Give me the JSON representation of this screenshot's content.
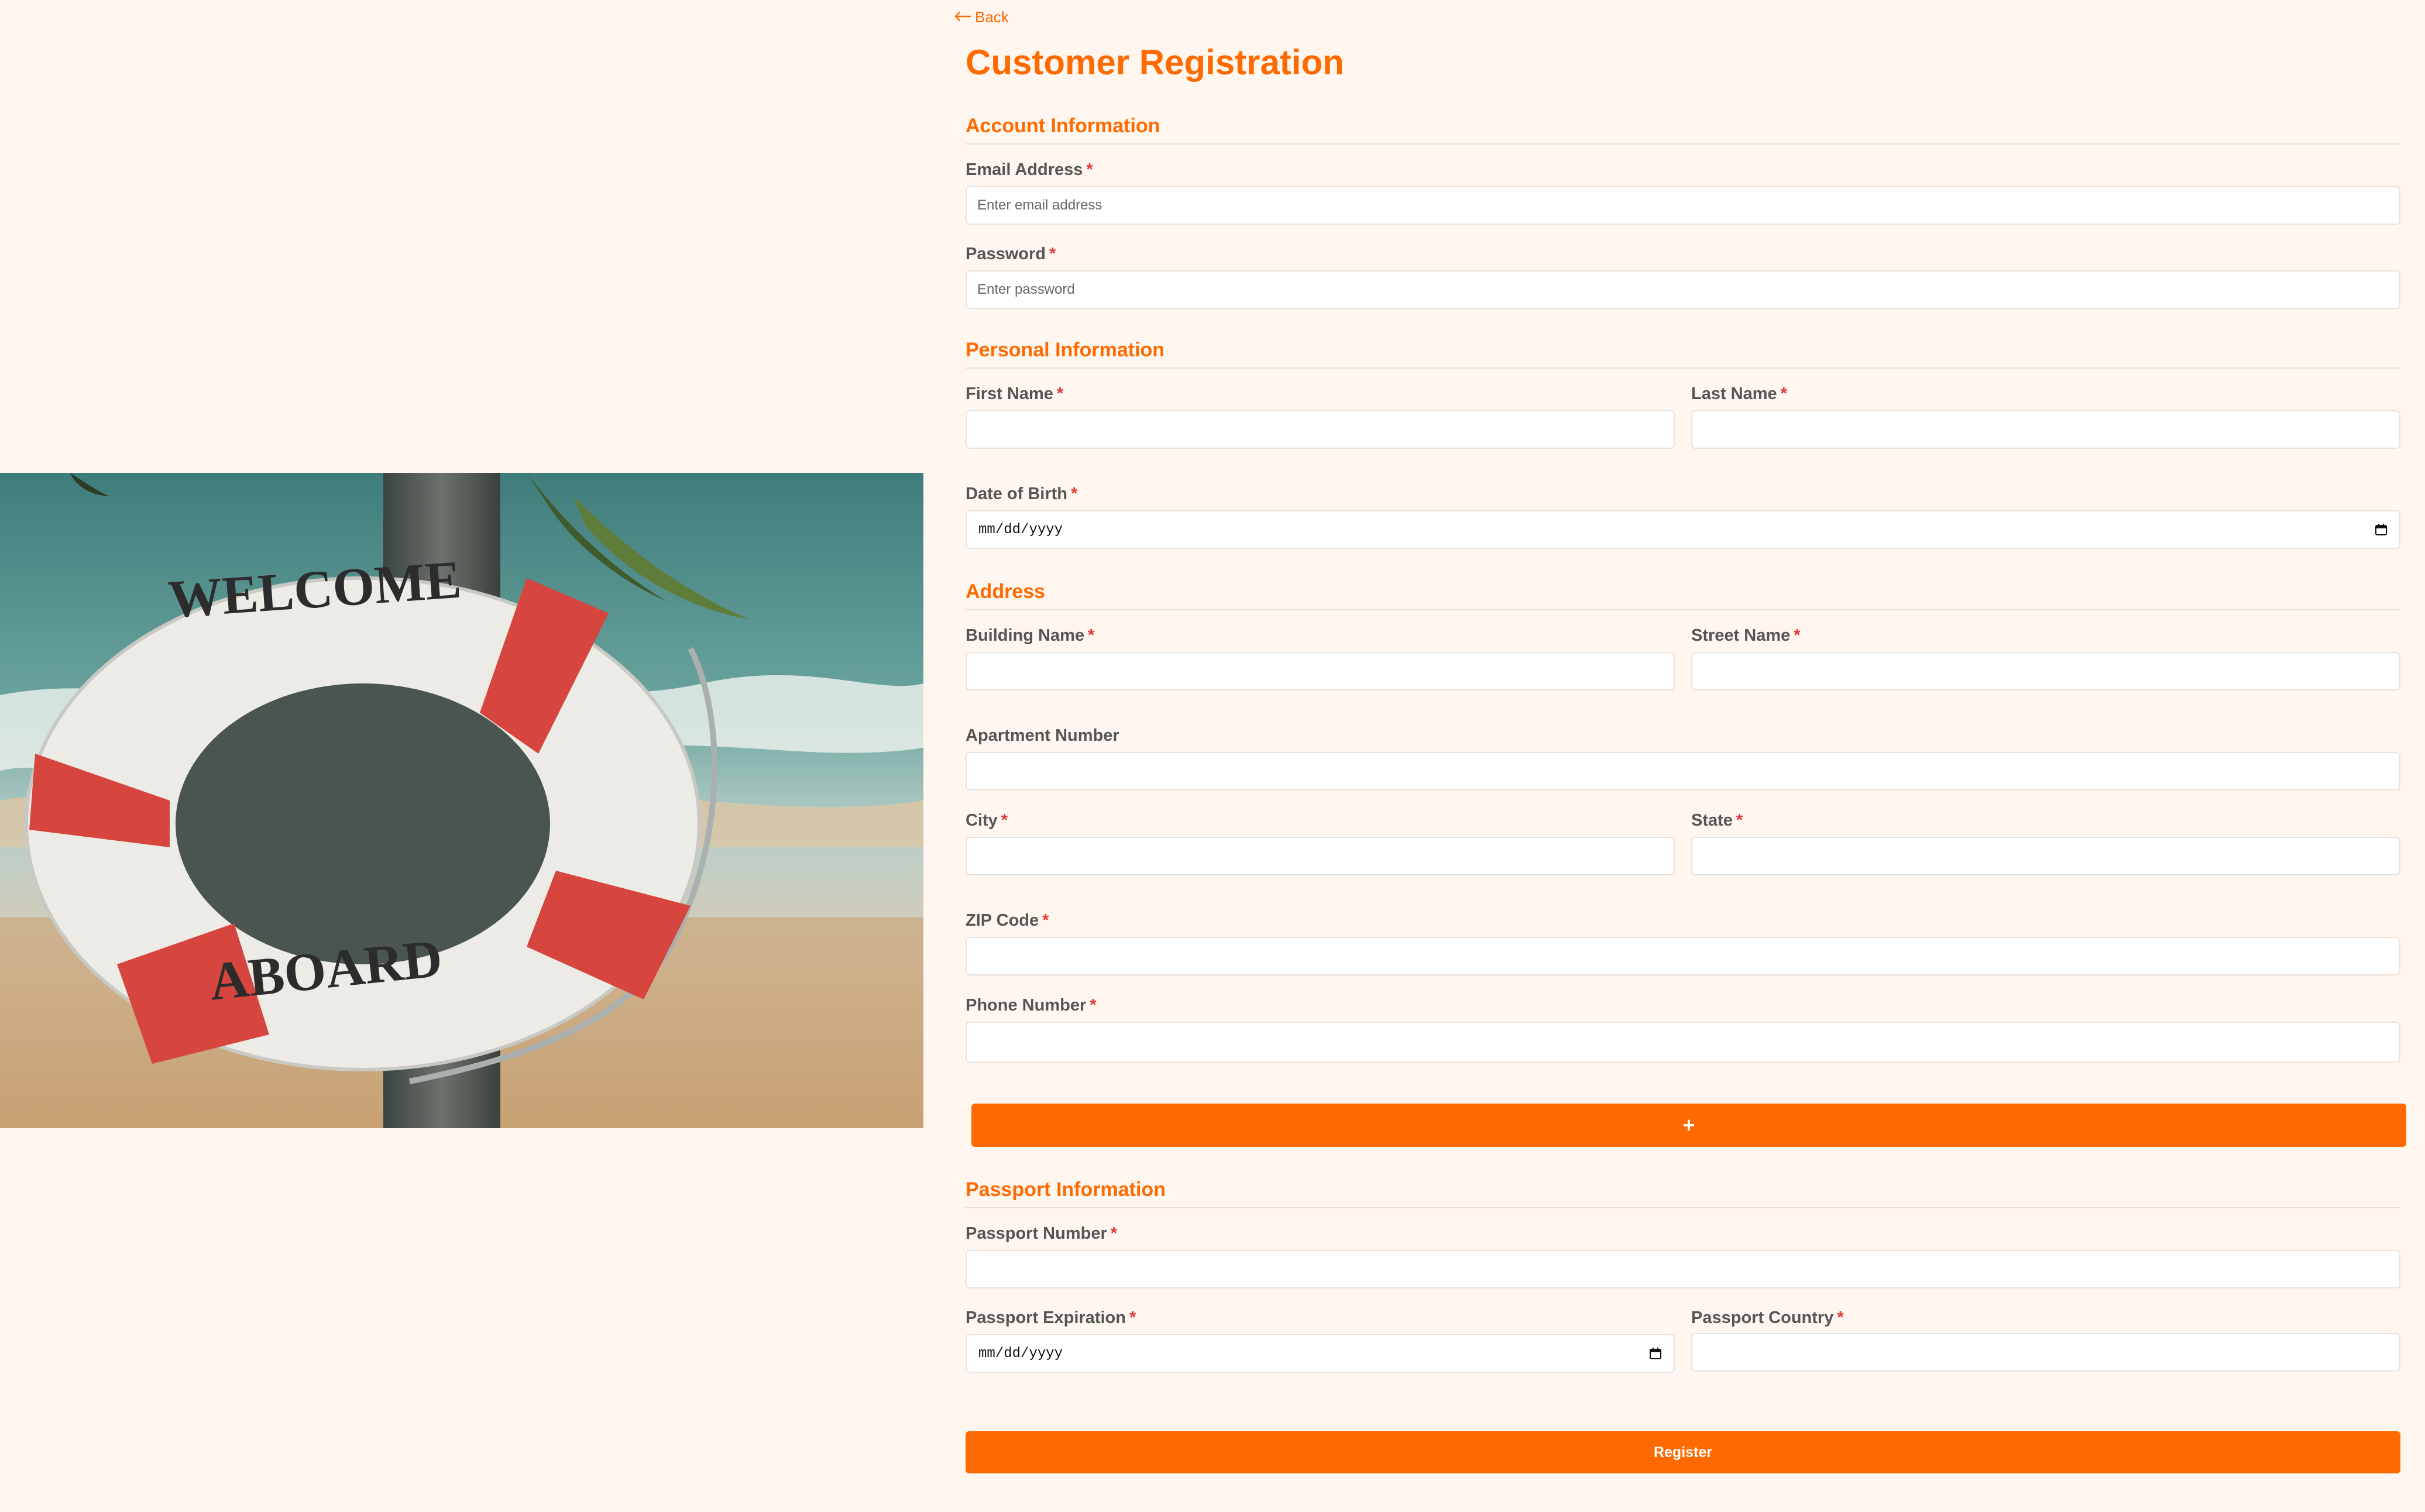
{
  "nav": {
    "back_label": "Back"
  },
  "page": {
    "title": "Customer Registration"
  },
  "hero": {
    "ring_top_text": "WELCOME",
    "ring_bottom_text": "ABOARD"
  },
  "sections": {
    "account": "Account Information",
    "personal": "Personal Information",
    "address": "Address",
    "passport": "Passport Information"
  },
  "fields": {
    "email": {
      "label": "Email Address",
      "placeholder": "Enter email address",
      "value": ""
    },
    "password": {
      "label": "Password",
      "placeholder": "Enter password",
      "value": ""
    },
    "first_name": {
      "label": "First Name",
      "value": ""
    },
    "last_name": {
      "label": "Last Name",
      "value": ""
    },
    "dob": {
      "label": "Date of Birth",
      "value": "mm/dd/yyyy"
    },
    "building_name": {
      "label": "Building Name",
      "value": ""
    },
    "street_name": {
      "label": "Street Name",
      "value": ""
    },
    "apartment_number": {
      "label": "Apartment Number",
      "value": ""
    },
    "city": {
      "label": "City",
      "value": ""
    },
    "state": {
      "label": "State",
      "value": ""
    },
    "zip": {
      "label": "ZIP Code",
      "value": ""
    },
    "phone": {
      "label": "Phone Number",
      "value": ""
    },
    "passport_number": {
      "label": "Passport Number",
      "value": ""
    },
    "passport_expiration": {
      "label": "Passport Expiration",
      "value": "mm/dd/yyyy"
    },
    "passport_country": {
      "label": "Passport Country",
      "value": ""
    }
  },
  "required_marker": "*",
  "buttons": {
    "add_label": "+",
    "register_label": "Register"
  },
  "colors": {
    "accent": "#ff6a00",
    "background": "#fff6ef",
    "required": "#e53935"
  },
  "icons": {
    "back": "arrow-left-icon",
    "calendar": "calendar-icon",
    "add": "plus-icon"
  }
}
